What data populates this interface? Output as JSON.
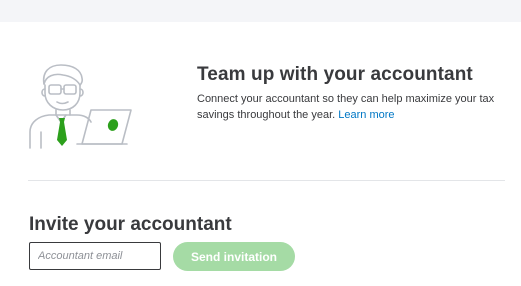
{
  "promo": {
    "title": "Team up with your accountant",
    "description": "Connect your accountant so they can help maximize your tax savings throughout the year.",
    "learn_more": "Learn more",
    "illustration_icon": "accountant-with-laptop-icon"
  },
  "invite": {
    "title": "Invite your accountant",
    "email_placeholder": "Accountant email",
    "email_value": "",
    "send_label": "Send invitation"
  },
  "colors": {
    "text": "#393a3d",
    "link": "#0077c5",
    "brand_green": "#2ca01c",
    "button_disabled": "#a5dba5",
    "divider": "#e3e5e8",
    "top_strip": "#f4f5f8"
  }
}
